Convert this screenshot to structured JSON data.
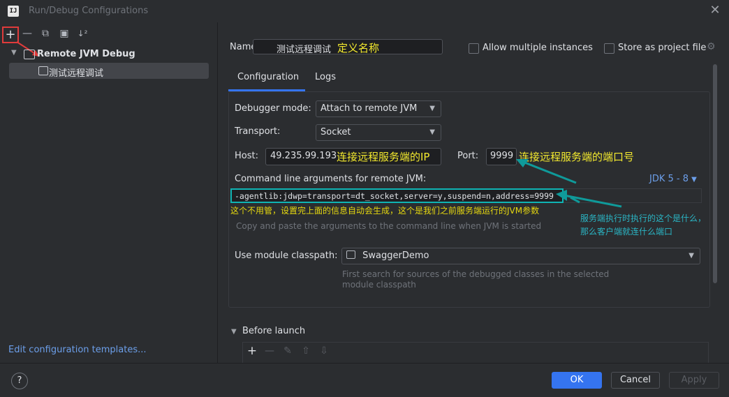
{
  "window": {
    "title": "Run/Debug Configurations",
    "logo": "IJ"
  },
  "left_toolbar": {
    "add": "+",
    "remove": "—",
    "copy": "⧉",
    "folder": "▣",
    "sort": "↓²"
  },
  "tree": {
    "root_label": "Remote JVM Debug",
    "child_label": "测试远程调试"
  },
  "edit_templates": "Edit configuration templates...",
  "form": {
    "name_label": "Name:",
    "name_value": "测试远程调试",
    "name_annotation": "定义名称",
    "allow_multiple": "Allow multiple instances",
    "store_as_project": "Store as project file",
    "tabs": [
      "Configuration",
      "Logs"
    ],
    "debugger_mode_label": "Debugger mode:",
    "debugger_mode_value": "Attach to remote JVM",
    "transport_label": "Transport:",
    "transport_value": "Socket",
    "host_label": "Host:",
    "host_value": "49.235.99.193",
    "host_annotation": "连接远程服务端的IP",
    "port_label": "Port:",
    "port_value": "9999",
    "port_annotation": "连接远程服务端的端口号",
    "cmd_label": "Command line arguments for remote JVM:",
    "jdk_selector": "JDK 5 - 8",
    "cmd_value": "-agentlib:jdwp=transport=dt_socket,server=y,suspend=n,address=9999",
    "cmd_annotation": "这个不用管，设置完上面的信息自动会生成，这个是我们之前服务端运行的JVM参数",
    "server_note_line1": "服务端执行时执行的这个是什么，",
    "server_note_line2": "那么客户端就连什么端口",
    "cmd_hint": "Copy and paste the arguments to the command line when JVM is started",
    "module_label": "Use module classpath:",
    "module_value": "SwaggerDemo",
    "module_hint_line1": "First search for sources of the debugged classes in the selected",
    "module_hint_line2": "module classpath",
    "before_launch": "Before launch"
  },
  "before_launch_toolbar": {
    "add": "+",
    "remove": "—",
    "edit": "✎",
    "up": "⇧",
    "down": "⇩"
  },
  "footer": {
    "help": "?",
    "ok": "OK",
    "cancel": "Cancel",
    "apply": "Apply"
  },
  "colors": {
    "accent": "#3574f0",
    "annotation_yellow": "#f4ea2e",
    "annotation_teal": "#2bb5c4",
    "highlight_red": "#e03b3b"
  }
}
